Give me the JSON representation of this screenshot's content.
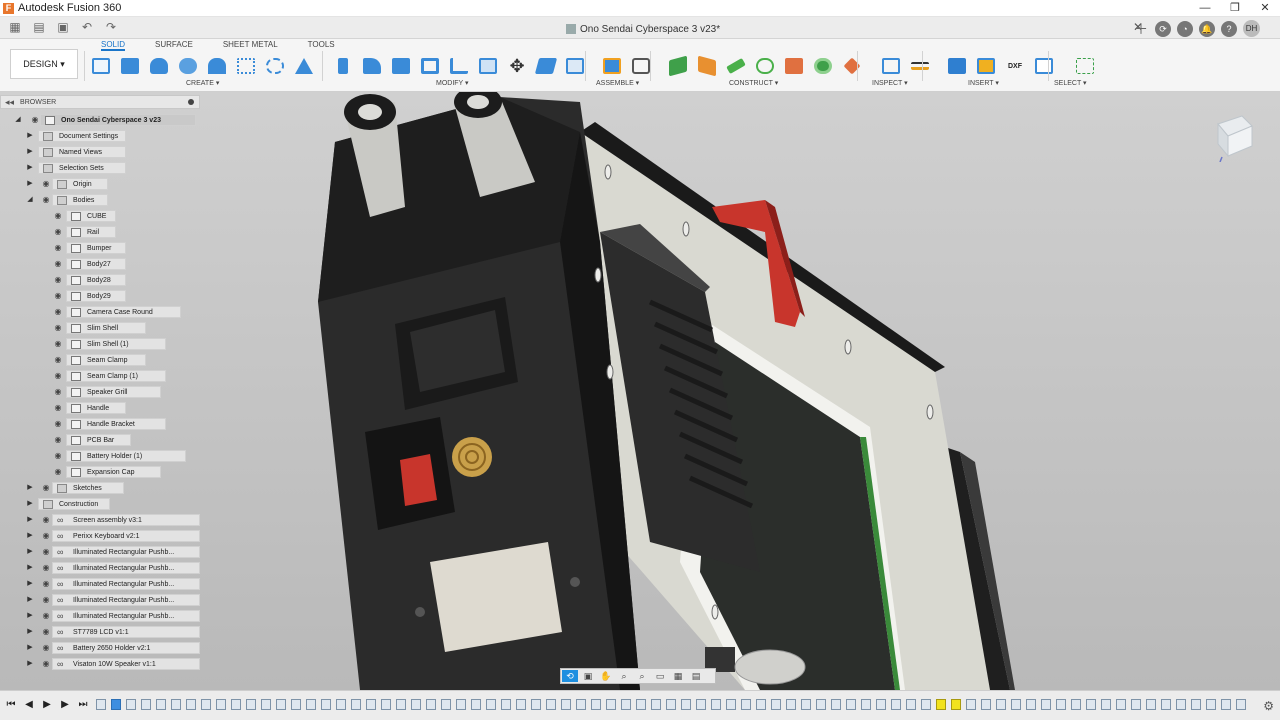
{
  "app": {
    "title": "Autodesk Fusion 360",
    "icon": "F",
    "window_controls": [
      "—",
      "❐",
      "✕"
    ]
  },
  "document": {
    "tab_title": "Ono Sendai Cyberspace 3 v23*",
    "close_label": "✕",
    "user_initials": "DH"
  },
  "toolbar": {
    "workspace_label": "DESIGN ▾",
    "tabs": [
      "SOLID",
      "SURFACE",
      "SHEET METAL",
      "TOOLS"
    ],
    "groups": [
      "CREATE ▾",
      "MODIFY ▾",
      "ASSEMBLE ▾",
      "CONSTRUCT ▾",
      "INSPECT ▾",
      "INSERT ▾",
      "SELECT ▾"
    ]
  },
  "browser": {
    "title": "BROWSER",
    "root": "Ono Sendai Cyberspace 3 v23",
    "folders": [
      "Document Settings",
      "Named Views",
      "Selection Sets",
      "Origin",
      "Bodies"
    ],
    "bodies": [
      "CUBE",
      "Rail",
      "Bumper",
      "Body27",
      "Body28",
      "Body29",
      "Camera Case Round",
      "Slim Shell",
      "Slim Shell (1)",
      "Seam Clamp",
      "Seam Clamp (1)",
      "Speaker Grill",
      "Handle",
      "Handle Bracket",
      "PCB Bar",
      "Battery Holder (1)",
      "Expansion Cap"
    ],
    "after_bodies": [
      "Sketches",
      "Construction"
    ],
    "components": [
      "Screen assembly v3:1",
      "Perixx Keyboard v2:1",
      "Illuminated Rectangular Pushb...",
      "Illuminated Rectangular Pushb...",
      "Illuminated Rectangular Pushb...",
      "Illuminated Rectangular Pushb...",
      "Illuminated Rectangular Pushb...",
      "ST7789 LCD v1:1",
      "Battery 2650 Holder v2:1",
      "Visaton 10W Speaker v1:1"
    ]
  },
  "colors": {
    "accent": "#1a75c9",
    "viewport_bg": "#c4c4c4",
    "case_dark": "#2a2a2a",
    "plate_light": "#dcdcd4",
    "red_button": "#c8352c",
    "knob_gold": "#c9a04a"
  }
}
